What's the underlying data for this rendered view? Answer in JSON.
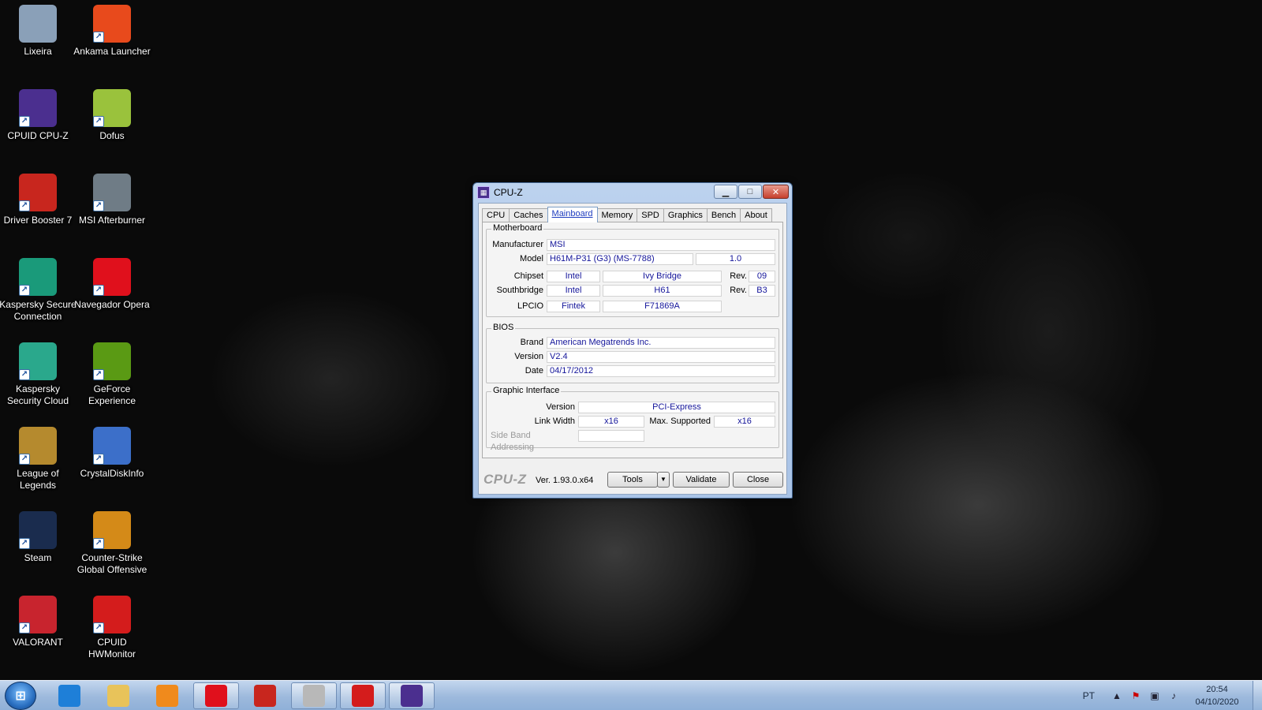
{
  "desktop": {
    "icons": [
      {
        "label": "Lixeira",
        "icon": "recycle-bin-icon",
        "color": "#8aa0b8"
      },
      {
        "label": "Ankama Launcher",
        "icon": "ankama-launcher-icon",
        "color": "#e84a1c"
      },
      {
        "label": "CPUID CPU-Z",
        "icon": "cpu-z-icon",
        "color": "#4b2f8f"
      },
      {
        "label": "Dofus",
        "icon": "dofus-egg-icon",
        "color": "#9ac23c"
      },
      {
        "label": "Driver Booster 7",
        "icon": "driver-booster-icon",
        "color": "#c8261e"
      },
      {
        "label": "MSI Afterburner",
        "icon": "msi-afterburner-icon",
        "color": "#6f7c86"
      },
      {
        "label": "Kaspersky Secure Connection",
        "icon": "kaspersky-vpn-icon",
        "color": "#1a9a7a"
      },
      {
        "label": "Navegador Opera",
        "icon": "opera-icon",
        "color": "#e0101c"
      },
      {
        "label": "Kaspersky Security Cloud",
        "icon": "kaspersky-cloud-icon",
        "color": "#2aa88c"
      },
      {
        "label": "GeForce Experience",
        "icon": "geforce-icon",
        "color": "#5a9a14"
      },
      {
        "label": "League of Legends",
        "icon": "league-of-legends-icon",
        "color": "#b58a2e"
      },
      {
        "label": "CrystalDiskInfo",
        "icon": "crystaldiskinfo-icon",
        "color": "#3c6fc9"
      },
      {
        "label": "Steam",
        "icon": "steam-icon",
        "color": "#1a2c4e"
      },
      {
        "label": "Counter-Strike Global Offensive",
        "icon": "csgo-icon",
        "color": "#d48a18"
      },
      {
        "label": "VALORANT",
        "icon": "valorant-icon",
        "color": "#c8242e"
      },
      {
        "label": "CPUID HWMonitor",
        "icon": "hwmonitor-icon",
        "color": "#d41c1c"
      }
    ]
  },
  "window": {
    "title": "CPU-Z",
    "tabs": [
      "CPU",
      "Caches",
      "Mainboard",
      "Memory",
      "SPD",
      "Graphics",
      "Bench",
      "About"
    ],
    "active_tab": "Mainboard",
    "motherboard": {
      "legend": "Motherboard",
      "manufacturer_label": "Manufacturer",
      "manufacturer": "MSI",
      "model_label": "Model",
      "model": "H61M-P31 (G3) (MS-7788)",
      "model_rev": "1.0",
      "chipset_label": "Chipset",
      "chipset_vendor": "Intel",
      "chipset_name": "Ivy Bridge",
      "chipset_rev_label": "Rev.",
      "chipset_rev": "09",
      "southbridge_label": "Southbridge",
      "southbridge_vendor": "Intel",
      "southbridge_name": "H61",
      "southbridge_rev_label": "Rev.",
      "southbridge_rev": "B3",
      "lpcio_label": "LPCIO",
      "lpcio_vendor": "Fintek",
      "lpcio_name": "F71869A"
    },
    "bios": {
      "legend": "BIOS",
      "brand_label": "Brand",
      "brand": "American Megatrends Inc.",
      "version_label": "Version",
      "version": "V2.4",
      "date_label": "Date",
      "date": "04/17/2012"
    },
    "graphic_interface": {
      "legend": "Graphic Interface",
      "version_label": "Version",
      "version": "PCI-Express",
      "link_width_label": "Link Width",
      "link_width": "x16",
      "max_supported_label": "Max. Supported",
      "max_supported": "x16",
      "side_band_label": "Side Band Addressing",
      "side_band": ""
    },
    "footer": {
      "logo": "CPU-Z",
      "version": "Ver. 1.93.0.x64",
      "tools_label": "Tools",
      "validate_label": "Validate",
      "close_label": "Close"
    }
  },
  "taskbar": {
    "items": [
      {
        "icon": "internet-explorer-icon",
        "color": "#1e7fd8",
        "open": false
      },
      {
        "icon": "file-explorer-icon",
        "color": "#e8c35a",
        "open": false
      },
      {
        "icon": "media-player-icon",
        "color": "#f08a1c",
        "open": false
      },
      {
        "icon": "opera-icon",
        "color": "#e0101c",
        "open": true
      },
      {
        "icon": "driver-booster-icon",
        "color": "#c8261e",
        "open": false
      },
      {
        "icon": "utility-icon",
        "color": "#b8b8b8",
        "open": true
      },
      {
        "icon": "hwmonitor-icon",
        "color": "#d41c1c",
        "open": true
      },
      {
        "icon": "cpu-z-icon",
        "color": "#4b2f8f",
        "open": true
      }
    ],
    "language": "PT",
    "time": "20:54",
    "date": "04/10/2020"
  }
}
